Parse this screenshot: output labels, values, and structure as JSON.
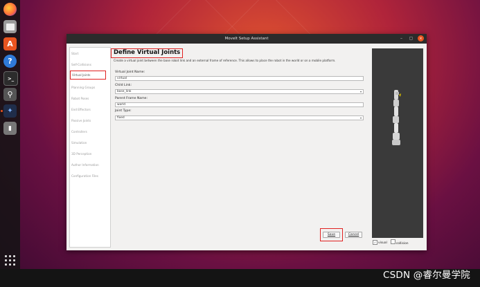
{
  "window": {
    "title": "MoveIt Setup Assistant",
    "controls": [
      "–",
      "▢",
      "×"
    ]
  },
  "sidebar": {
    "items": [
      {
        "label": "Start"
      },
      {
        "label": "Self-Collisions"
      },
      {
        "label": "Virtual Joints"
      },
      {
        "label": "Planning Groups"
      },
      {
        "label": "Robot Poses"
      },
      {
        "label": "End Effectors"
      },
      {
        "label": "Passive Joints"
      },
      {
        "label": "Controllers"
      },
      {
        "label": "Simulation"
      },
      {
        "label": "3D Perception"
      },
      {
        "label": "Author Information"
      },
      {
        "label": "Configuration Files"
      }
    ],
    "active": "Virtual Joints"
  },
  "main": {
    "title": "Define Virtual Joints",
    "description": "Create a virtual joint between the base robot link and an external frame of reference. This allows to place the robot in the world or on a mobile platform.",
    "fields": {
      "joint_name_label": "Virtual Joint Name:",
      "joint_name_value": "virtual",
      "child_link_label": "Child Link:",
      "child_link_value": "base_link",
      "parent_frame_label": "Parent Frame Name:",
      "parent_frame_value": "world",
      "joint_type_label": "Joint Type:",
      "joint_type_value": "fixed"
    },
    "buttons": {
      "save": "Save",
      "cancel": "Cancel"
    }
  },
  "viewer": {
    "visual_label": "visual",
    "collision_label": "collision",
    "visual_checked": true,
    "collision_checked": false
  },
  "watermark": "CSDN @睿尔曼学院",
  "dock": {
    "icons": [
      "firefox-icon",
      "files-icon",
      "app-store-icon",
      "help-icon",
      "terminal-icon",
      "search-icon",
      "rviz-icon",
      "usb-drive-icon",
      "show-apps-icon"
    ]
  },
  "colors": {
    "highlight": "#e02020",
    "titlebar": "#2b2b2b",
    "close_button": "#e95420"
  }
}
